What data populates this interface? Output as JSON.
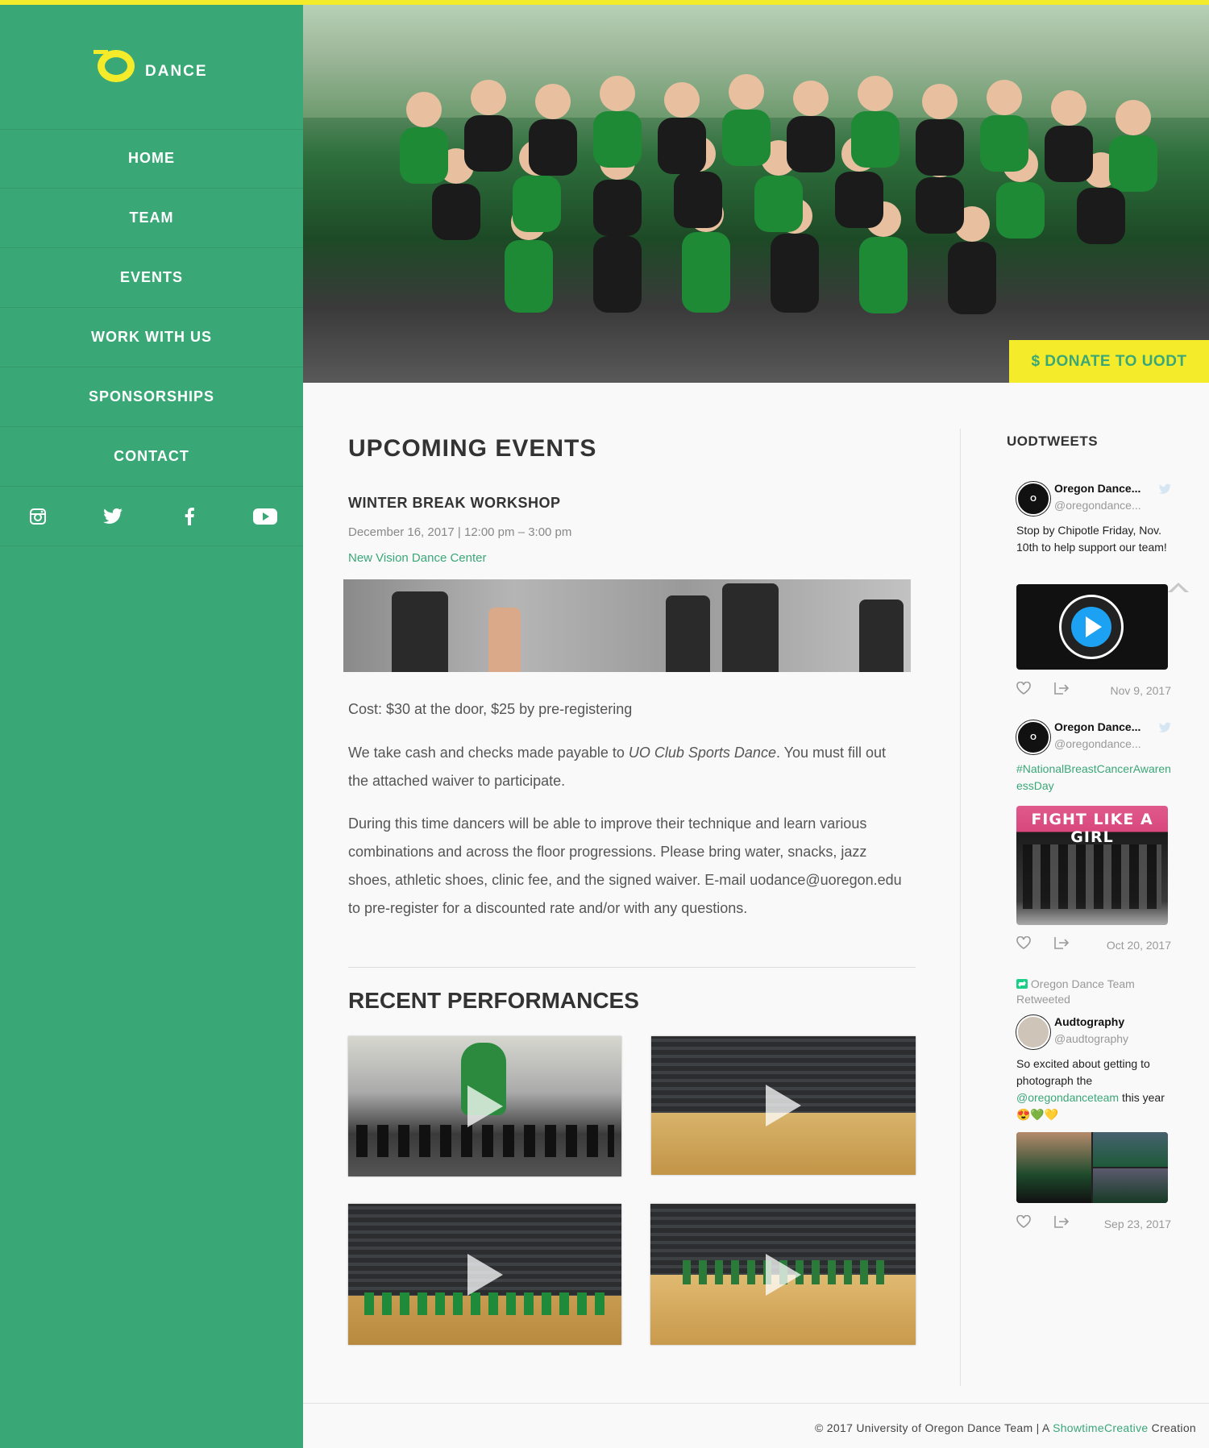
{
  "brand": {
    "logo_text": "DANCE",
    "primary_color": "#3aa777",
    "accent_color": "#f4ec2b"
  },
  "nav": [
    {
      "label": "HOME"
    },
    {
      "label": "TEAM"
    },
    {
      "label": "EVENTS"
    },
    {
      "label": "WORK WITH US"
    },
    {
      "label": "SPONSORSHIPS"
    },
    {
      "label": "CONTACT"
    }
  ],
  "social": [
    "instagram-icon",
    "twitter-icon",
    "facebook-icon",
    "youtube-icon"
  ],
  "hero": {
    "donate_label": "$ DONATE TO UODT"
  },
  "events": {
    "heading": "UPCOMING EVENTS",
    "title": "WINTER BREAK WORKSHOP",
    "date": "December 16, 2017 | 12:00 pm – 3:00 pm",
    "location": "New Vision Dance Center",
    "cost": "Cost: $30 at the door, $25 by pre-registering",
    "payment_pre": "We take cash and checks made payable to ",
    "payment_em": "UO Club Sports Dance",
    "payment_post": ". You must fill out the attached waiver to participate.",
    "details": "During this time dancers will be able to improve their technique and learn various combinations and across the floor progressions. Please bring water, snacks, jazz shoes, athletic shoes, clinic fee, and the signed waiver. E-mail uodance@uoregon.edu to pre-register for a discounted rate and/or with any questions."
  },
  "performances": {
    "heading": "RECENT PERFORMANCES"
  },
  "tweets": {
    "heading": "UODTWEETS",
    "items": [
      {
        "name": "Oregon Dance...",
        "handle": "@oregondance...",
        "text": "Stop by Chipotle Friday, Nov. 10th to help support our team!",
        "date": "Nov 9, 2017"
      },
      {
        "name": "Oregon Dance...",
        "handle": "@oregondance...",
        "text": "#NationalBreastCancerAwarenessDay",
        "media_text": "FIGHT LIKE A GIRL",
        "date": "Oct 20, 2017"
      },
      {
        "retweet_label": "Oregon Dance Team Retweeted",
        "name": "Audtography",
        "handle": "@audtography",
        "text_pre": "So excited about getting to photograph the ",
        "mention": "@oregondanceteam",
        "text_post": " this year",
        "emoji": "😍💚💛",
        "date": "Sep 23, 2017"
      }
    ]
  },
  "footer": {
    "text_pre": "© 2017 University of Oregon Dance Team | A ",
    "link": "ShowtimeCreative",
    "text_post": " Creation"
  }
}
